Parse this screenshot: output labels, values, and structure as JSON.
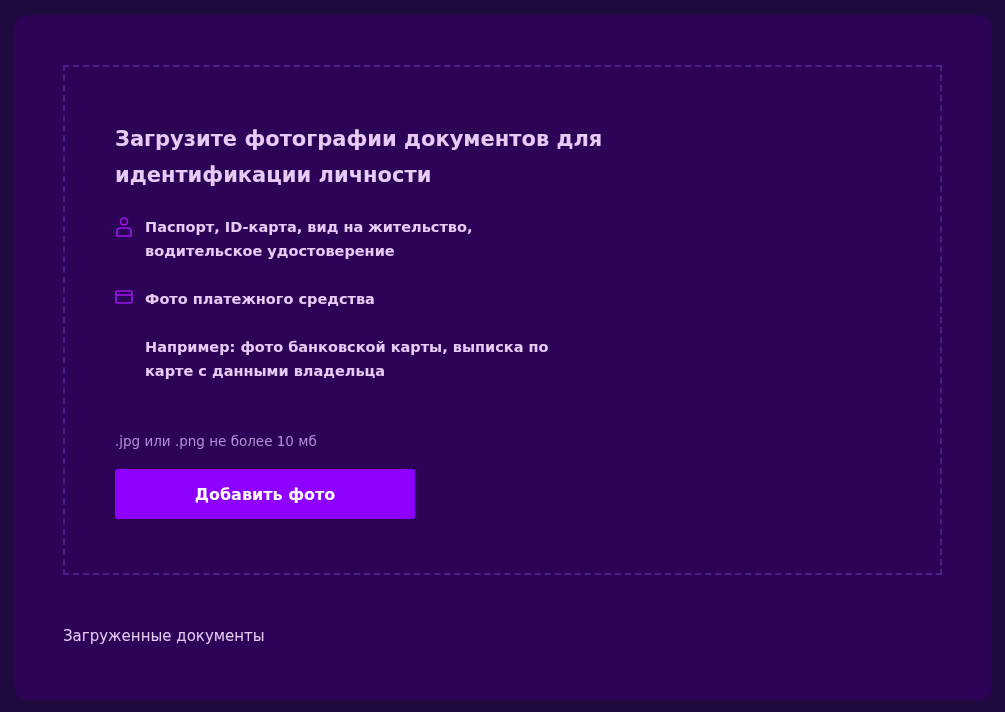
{
  "upload": {
    "title": "Загрузите фотографии документов для идентификации личности",
    "items": [
      {
        "kind": "person",
        "text": "Паспорт, ID-карта, вид на жительство, водительское удостоверение"
      },
      {
        "kind": "card",
        "text": "Фото платежного средства"
      },
      {
        "kind": "note",
        "text": "Например: фото банковской карты, выписка по карте с данными владельца"
      }
    ],
    "hint": ".jpg или .png не более 10 мб",
    "button": "Добавить фото"
  },
  "uploaded": {
    "title": "Загруженные документы"
  }
}
